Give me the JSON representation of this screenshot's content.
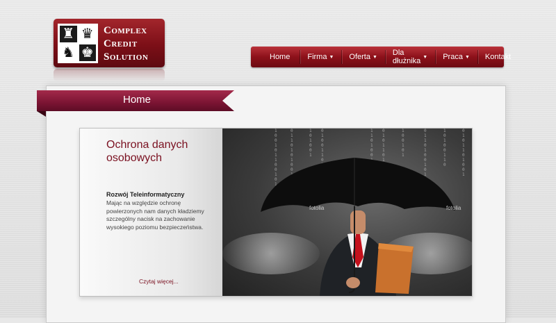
{
  "logo": {
    "line1": "Complex",
    "line2": "Credit",
    "line3": "Solution",
    "pieces": [
      "♜",
      "♛",
      "♞",
      "♚"
    ]
  },
  "nav": {
    "items": [
      {
        "label": "Home",
        "dropdown": false
      },
      {
        "label": "Firma",
        "dropdown": true
      },
      {
        "label": "Oferta",
        "dropdown": true
      },
      {
        "label": "Dla dłużnika",
        "dropdown": true
      },
      {
        "label": "Praca",
        "dropdown": true
      },
      {
        "label": "Kontakt",
        "dropdown": false
      }
    ],
    "caret": "▼"
  },
  "page": {
    "title": "Home"
  },
  "slide": {
    "heading": "Ochrona danych osobowych",
    "subtitle": "Rozwój Teleinformatyczny",
    "body": "Mając na względzie ochronę powierzonych nam danych kładziemy szczególny nacisk na zachowanie wysokiego poziomu bezpieczeństwa.",
    "more_link": "Czytaj więcej...",
    "watermark": "fotolia"
  },
  "colors": {
    "brand": "#8c111a",
    "ribbon": "#7b1433",
    "heading": "#7a1020"
  }
}
